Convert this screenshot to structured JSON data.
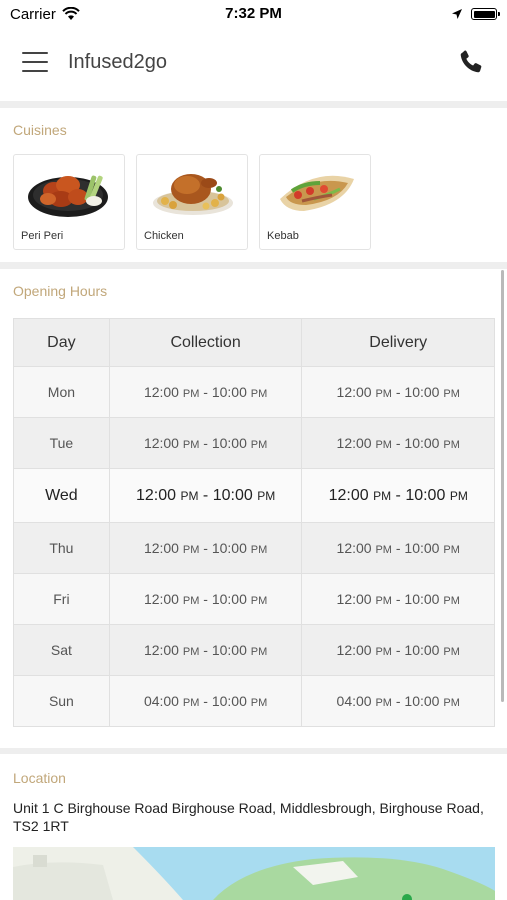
{
  "status_bar": {
    "carrier": "Carrier",
    "time": "7:32 PM"
  },
  "header": {
    "title": "Infused2go",
    "menu_icon": "hamburger-menu-icon",
    "phone_icon": "phone-icon"
  },
  "cuisines": {
    "title": "Cuisines",
    "items": [
      {
        "label": "Peri Peri",
        "image": "peri-peri-wings-image"
      },
      {
        "label": "Chicken",
        "image": "roast-chicken-image"
      },
      {
        "label": "Kebab",
        "image": "kebab-wrap-image"
      }
    ]
  },
  "opening_hours": {
    "title": "Opening Hours",
    "headers": {
      "day": "Day",
      "collection": "Collection",
      "delivery": "Delivery"
    },
    "rows": [
      {
        "day": "Mon",
        "collection": {
          "open": "12:00",
          "open_p": "PM",
          "sep": " - ",
          "close": "10:00",
          "close_p": "PM"
        },
        "delivery": {
          "open": "12:00",
          "open_p": "PM",
          "sep": " - ",
          "close": "10:00",
          "close_p": "PM"
        }
      },
      {
        "day": "Tue",
        "collection": {
          "open": "12:00",
          "open_p": "PM",
          "sep": " - ",
          "close": "10:00",
          "close_p": "PM"
        },
        "delivery": {
          "open": "12:00",
          "open_p": "PM",
          "sep": " - ",
          "close": "10:00",
          "close_p": "PM"
        }
      },
      {
        "day": "Wed",
        "collection": {
          "open": "12:00",
          "open_p": "PM",
          "sep": " - ",
          "close": "10:00",
          "close_p": "PM"
        },
        "delivery": {
          "open": "12:00",
          "open_p": "PM",
          "sep": " - ",
          "close": "10:00",
          "close_p": "PM"
        }
      },
      {
        "day": "Thu",
        "collection": {
          "open": "12:00",
          "open_p": "PM",
          "sep": " - ",
          "close": "10:00",
          "close_p": "PM"
        },
        "delivery": {
          "open": "12:00",
          "open_p": "PM",
          "sep": " - ",
          "close": "10:00",
          "close_p": "PM"
        }
      },
      {
        "day": "Fri",
        "collection": {
          "open": "12:00",
          "open_p": "PM",
          "sep": " - ",
          "close": "10:00",
          "close_p": "PM"
        },
        "delivery": {
          "open": "12:00",
          "open_p": "PM",
          "sep": " - ",
          "close": "10:00",
          "close_p": "PM"
        }
      },
      {
        "day": "Sat",
        "collection": {
          "open": "12:00",
          "open_p": "PM",
          "sep": " - ",
          "close": "10:00",
          "close_p": "PM"
        },
        "delivery": {
          "open": "12:00",
          "open_p": "PM",
          "sep": " - ",
          "close": "10:00",
          "close_p": "PM"
        }
      },
      {
        "day": "Sun",
        "collection": {
          "open": "04:00",
          "open_p": "PM",
          "sep": " - ",
          "close": "10:00",
          "close_p": "PM"
        },
        "delivery": {
          "open": "04:00",
          "open_p": "PM",
          "sep": " - ",
          "close": "10:00",
          "close_p": "PM"
        }
      }
    ]
  },
  "location": {
    "title": "Location",
    "address": "Unit 1 C Birghouse Road Birghouse Road, Middlesbrough, Birghouse Road, TS2 1RT",
    "map": "map-preview"
  },
  "colors": {
    "section_title": "#c1a77a",
    "divider": "#eeeeee",
    "table_header_bg": "#eeeeee",
    "map_water": "#a8dcf0",
    "map_land": "#a9d9a0"
  }
}
